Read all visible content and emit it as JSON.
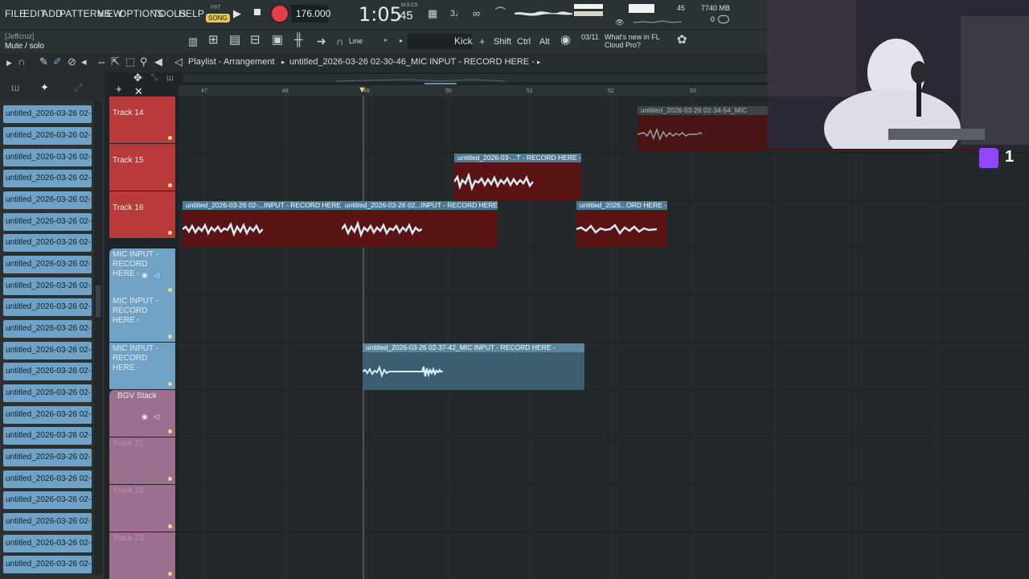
{
  "menu": [
    "FILE",
    "EDIT",
    "ADD",
    "PATTERNS",
    "VIEW",
    "OPTIONS",
    "TOOLS",
    "HELP"
  ],
  "pat_song": {
    "pat": "PAT",
    "song": "SONG"
  },
  "tempo": "176.000",
  "time": {
    "main": "1:05",
    "sub": "45",
    "label": "M:S:CS"
  },
  "memory": "7740 MB",
  "cpu": "45",
  "voices": "0",
  "hint": {
    "user": "[Jeffcruz]",
    "text": "Mute / solo"
  },
  "snap": "Line",
  "channel": "Kick",
  "mods": [
    "Shift",
    "Ctrl",
    "Alt"
  ],
  "news": {
    "date": "03/11",
    "text": "What's new in FL Cloud Pro?"
  },
  "playlist": {
    "title": "Playlist - Arrangement",
    "pattern": "untitled_2026-03-26 02-30-46_MIC INPUT - RECORD HERE -"
  },
  "ruler": [
    "47",
    "48",
    "49",
    "50",
    "51",
    "52",
    "53"
  ],
  "picker_label": "untitled_2026-03-26 02-...",
  "tracks": {
    "t14": "Track 14",
    "t15": "Track 15",
    "t16": "Track 16",
    "mic1": "MIC INPUT - RECORD HERE -",
    "mic2": "MIC INPUT - RECORD HERE -",
    "mic3": "MIC INPUT - RECORD HERE -",
    "bgv": "BGV Stack",
    "t21": "Track 21",
    "t22": "Track 22",
    "t23": "Track 23"
  },
  "clips": {
    "c1": "untitled_2026-03-26 02-34-54_MIC",
    "c2": "untitled_2026-03-...T - RECORD HERE -",
    "c3": "untitled_2026-03-26 02-...INPUT - RECORD HERE -",
    "c4": "untitled_2026-03-26 02...INPUT - RECORD HERE -",
    "c5": "untitled_2026...ORD HERE -",
    "c6": "untitled_2026-03-26 02-37-42_MIC INPUT - RECORD HERE -"
  },
  "twitch": "1",
  "colors": {
    "accent": "#6fa2c4",
    "record": "#e0404a",
    "clip_red": "#5a1414"
  }
}
